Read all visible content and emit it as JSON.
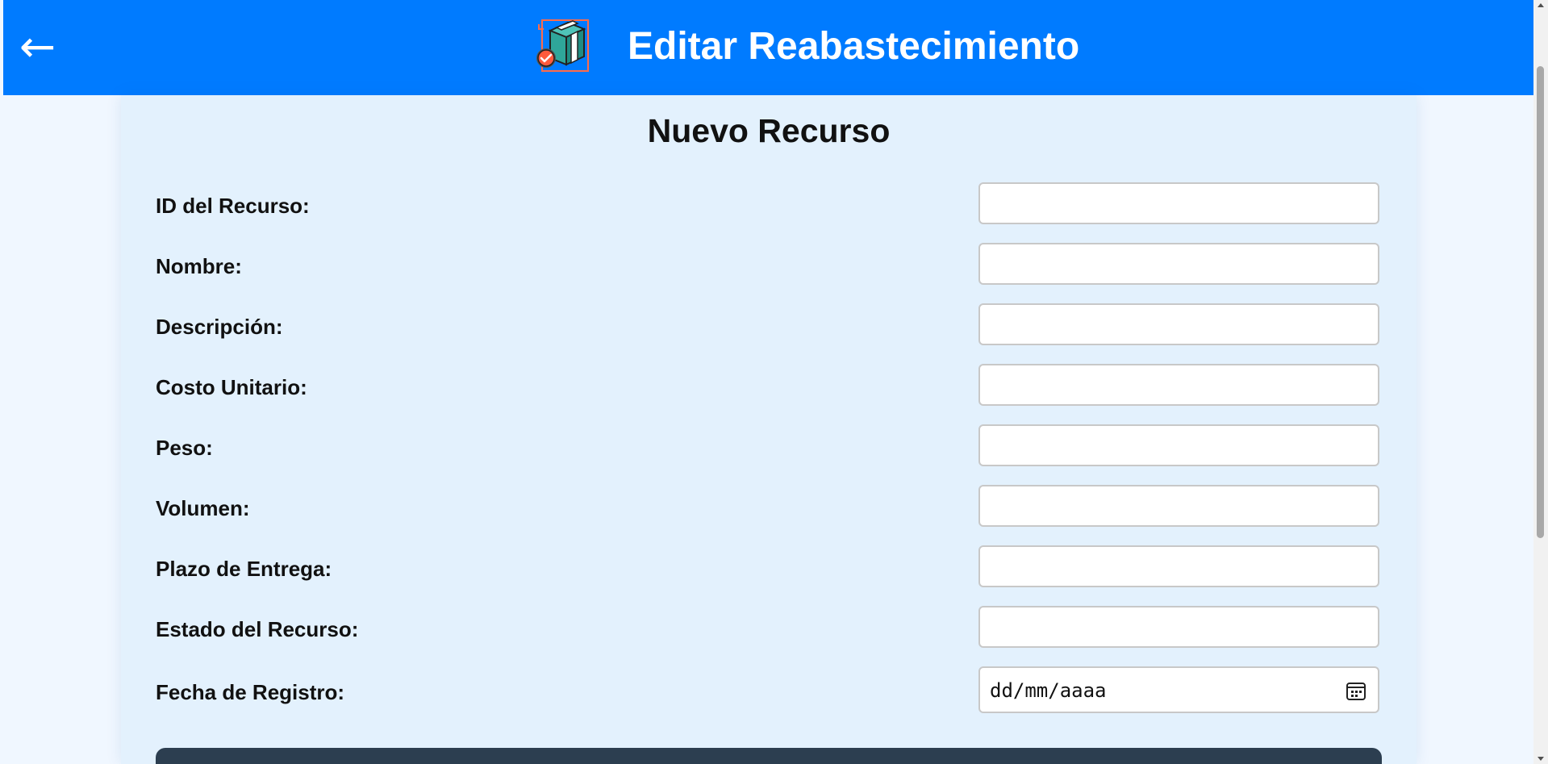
{
  "header": {
    "back_glyph": "←",
    "back_icon": "arrow-left-icon",
    "logo_icon": "package-restock-icon",
    "title": "Editar Reabastecimiento",
    "background_color": "#007bff"
  },
  "form": {
    "title": "Nuevo Recurso",
    "fields": [
      {
        "label": "ID del Recurso:",
        "value": ""
      },
      {
        "label": "Nombre:",
        "value": ""
      },
      {
        "label": "Descripción:",
        "value": ""
      },
      {
        "label": "Costo Unitario:",
        "value": ""
      },
      {
        "label": "Peso:",
        "value": ""
      },
      {
        "label": "Volumen:",
        "value": ""
      },
      {
        "label": "Plazo de Entrega:",
        "value": ""
      },
      {
        "label": "Estado del Recurso:",
        "value": ""
      }
    ],
    "date_field": {
      "label": "Fecha de Registro:",
      "placeholder": "dd/mm/aaaa",
      "icon": "calendar-icon"
    },
    "submit_color": "#2c3e50"
  }
}
